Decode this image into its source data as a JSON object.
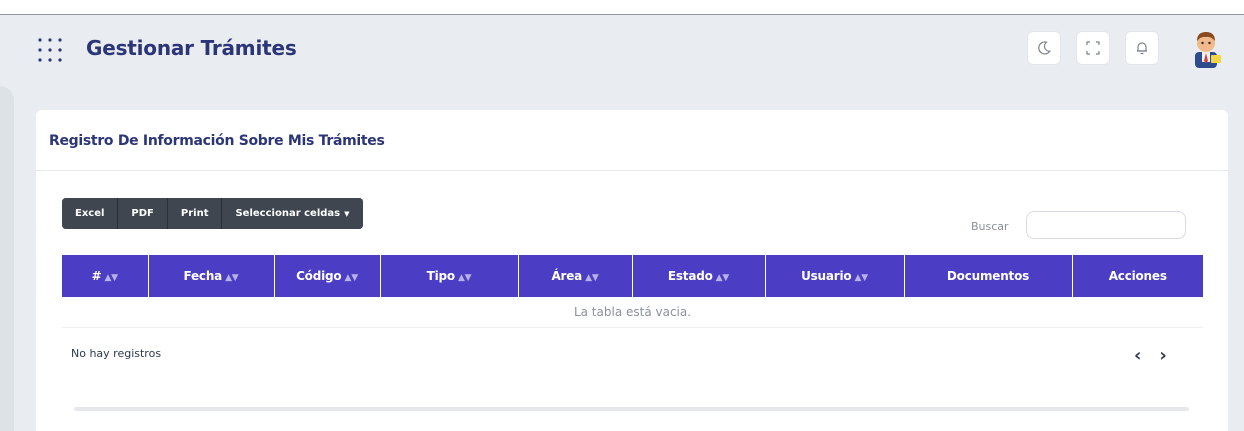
{
  "header": {
    "title": "Gestionar Trámites",
    "icons": [
      "grid-menu-icon",
      "moon-icon",
      "fullscreen-icon",
      "bell-icon",
      "avatar"
    ]
  },
  "card": {
    "title": "Registro De Información Sobre Mis Trámites"
  },
  "export_buttons": {
    "excel": "Excel",
    "pdf": "PDF",
    "print": "Print",
    "select_cells": "Seleccionar celdas"
  },
  "search": {
    "label": "Buscar",
    "value": ""
  },
  "table": {
    "columns": [
      {
        "label": "#",
        "sortable": true
      },
      {
        "label": "Fecha",
        "sortable": true
      },
      {
        "label": "Código",
        "sortable": true
      },
      {
        "label": "Tipo",
        "sortable": true
      },
      {
        "label": "Área",
        "sortable": true
      },
      {
        "label": "Estado",
        "sortable": true
      },
      {
        "label": "Usuario",
        "sortable": true
      },
      {
        "label": "Documentos",
        "sortable": false
      },
      {
        "label": "Acciones",
        "sortable": false
      }
    ],
    "empty_message": "La tabla está vacia."
  },
  "footer": {
    "info": "No hay registros",
    "prev": "‹",
    "next": "›"
  },
  "colors": {
    "accent": "#4b3ec4",
    "title": "#2c3577",
    "button_dark": "#3f4650",
    "background": "#e9edf1"
  }
}
